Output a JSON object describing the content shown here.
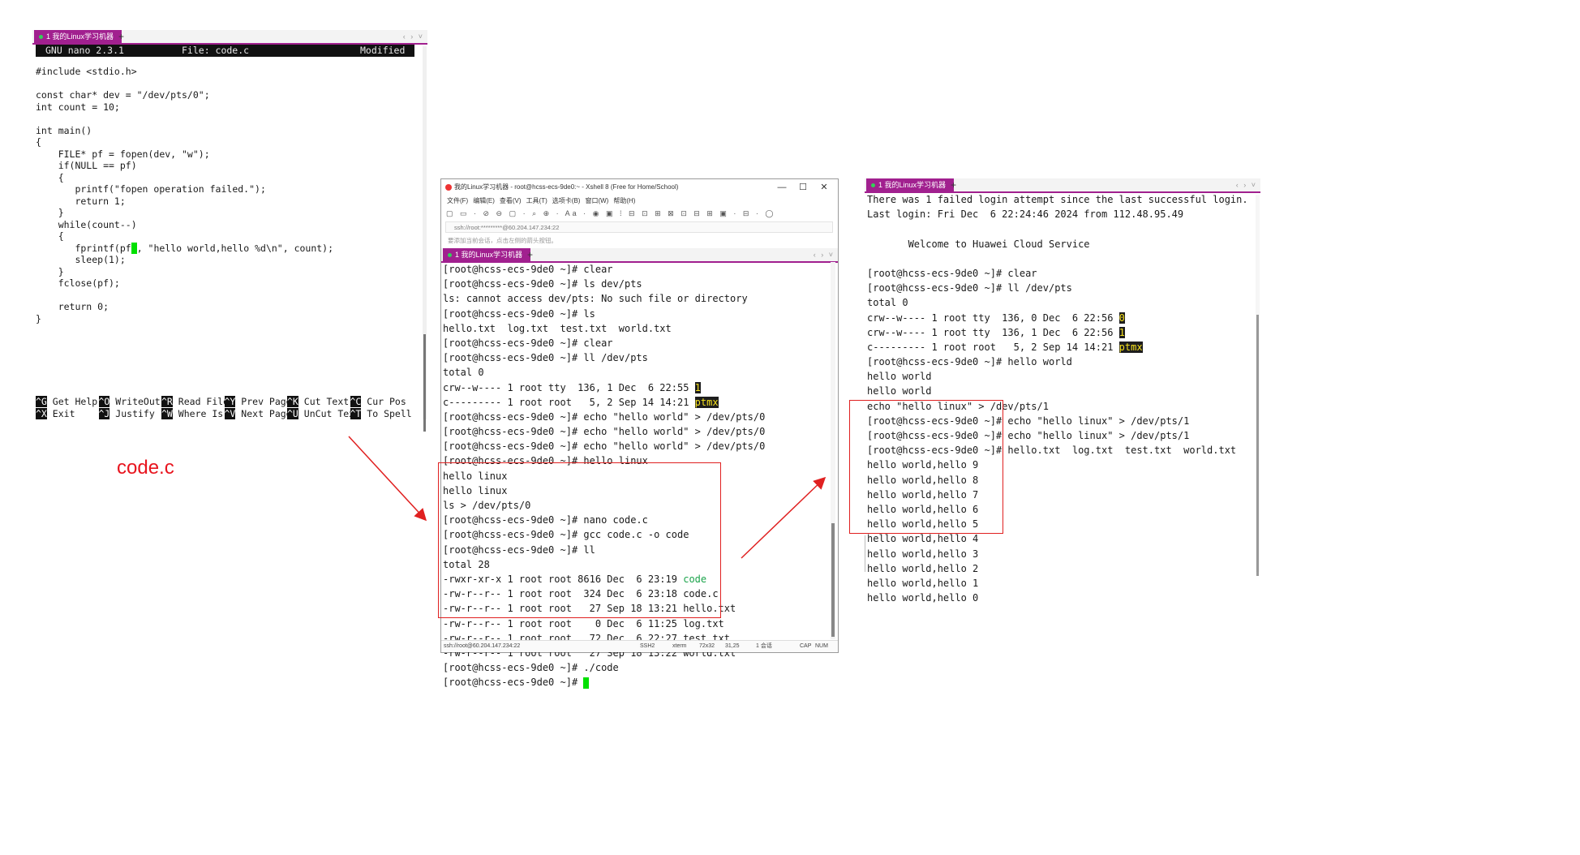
{
  "nano": {
    "tab_label": "1 我的Linux学习机器",
    "tab_plus": "+",
    "tab_nav": "‹ › ˅",
    "header_left": "GNU nano 2.3.1",
    "header_center": "File: code.c",
    "header_right": "Modified",
    "code_lines": [
      "#include <stdio.h>",
      "",
      "const char* dev = \"/dev/pts/0\";",
      "int count = 10;",
      "",
      "int main()",
      "{",
      "    FILE* pf = fopen(dev, \"w\");",
      "    if(NULL == pf)",
      "    {",
      "       printf(\"fopen operation failed.\");",
      "       return 1;",
      "    }",
      "    while(count--)",
      "    {",
      "       fprintf(pf",
      "       sleep(1);",
      "    }",
      "    fclose(pf);",
      "",
      "    return 0;",
      "}"
    ],
    "fprintf_rest": ", \"hello world,hello %d\\n\", count);",
    "shortcuts_row1": [
      {
        "key": "^G",
        "label": "Get Help"
      },
      {
        "key": "^O",
        "label": "WriteOut"
      },
      {
        "key": "^R",
        "label": "Read File"
      },
      {
        "key": "^Y",
        "label": "Prev Page"
      },
      {
        "key": "^K",
        "label": "Cut Text"
      },
      {
        "key": "^C",
        "label": "Cur Pos"
      }
    ],
    "shortcuts_row2": [
      {
        "key": "^X",
        "label": "Exit"
      },
      {
        "key": "^J",
        "label": "Justify"
      },
      {
        "key": "^W",
        "label": "Where Is"
      },
      {
        "key": "^V",
        "label": "Next Page"
      },
      {
        "key": "^U",
        "label": "UnCut Tex"
      },
      {
        "key": "^T",
        "label": "To Spell"
      }
    ]
  },
  "annotation_label": "code.c",
  "xshell": {
    "title": "我的Linux学习机器 - root@hcss-ecs-9de0:~ - Xshell 8 (Free for Home/School)",
    "window_buttons": {
      "minimize": "—",
      "maximize": "☐",
      "close": "✕"
    },
    "menu": [
      "文件(F)",
      "编辑(E)",
      "查看(V)",
      "工具(T)",
      "选项卡(B)",
      "窗口(W)",
      "帮助(H)"
    ],
    "toolbar_glyphs": "▢ ▭ · ⊘ ⊖ ▢ · ⌕ ⊕ · Aa · ◉ ▣ ⁞ ⊟ ⊡ ⊞ ⊠ ⊡ ⊟ ⊞ ▣ · ⊟ · ◯",
    "address": "ssh://root:*********@60.204.147.234:22",
    "tip": "要添加当前会话，点击左侧的箭头按钮。",
    "tab_label": "1 我的Linux学习机器",
    "tab_plus": "+",
    "tab_nav": "‹ › ˅",
    "status": {
      "conn": "ssh://root@60.204.147.234:22",
      "proto": "SSH2",
      "term": "xterm",
      "size": "72x32",
      "pos": "31,25",
      "sessions": "1 会话",
      "caps": "CAP",
      "num": "NUM"
    },
    "lines": [
      "[root@hcss-ecs-9de0 ~]# clear",
      "[root@hcss-ecs-9de0 ~]# ls dev/pts",
      "ls: cannot access dev/pts: No such file or directory",
      "[root@hcss-ecs-9de0 ~]# ls",
      "hello.txt  log.txt  test.txt  world.txt",
      "[root@hcss-ecs-9de0 ~]# clear",
      "[root@hcss-ecs-9de0 ~]# ll /dev/pts",
      "total 0",
      "crw--w---- 1 root tty  136, 1 Dec  6 22:55 ",
      "c--------- 1 root root   5, 2 Sep 14 14:21 ",
      "[root@hcss-ecs-9de0 ~]# echo \"hello world\" > /dev/pts/0",
      "[root@hcss-ecs-9de0 ~]# echo \"hello world\" > /dev/pts/0",
      "[root@hcss-ecs-9de0 ~]# echo \"hello world\" > /dev/pts/0",
      "[root@hcss-ecs-9de0 ~]# hello linux",
      "hello linux",
      "hello linux",
      "ls > /dev/pts/0",
      "[root@hcss-ecs-9de0 ~]# nano code.c",
      "[root@hcss-ecs-9de0 ~]# gcc code.c -o code",
      "[root@hcss-ecs-9de0 ~]# ll",
      "total 28",
      "-rwxr-xr-x 1 root root 8616 Dec  6 23:19 ",
      "-rw-r--r-- 1 root root  324 Dec  6 23:18 code.c",
      "-rw-r--r-- 1 root root   27 Sep 18 13:21 hello.txt",
      "-rw-r--r-- 1 root root    0 Dec  6 11:25 log.txt",
      "-rw-r--r-- 1 root root   72 Dec  6 22:27 test.txt",
      "-rw-r--r-- 1 root root   27 Sep 18 13:22 world.txt",
      "[root@hcss-ecs-9de0 ~]# ./code",
      "[root@hcss-ecs-9de0 ~]# "
    ],
    "hl_pts1": "1",
    "hl_ptmx": "ptmx",
    "exe_name": "code"
  },
  "right": {
    "tab_label": "1 我的Linux学习机器",
    "tab_plus": "+",
    "tab_nav": "‹ › ˅",
    "lines": [
      "There was 1 failed login attempt since the last successful login.",
      "Last login: Fri Dec  6 22:24:46 2024 from 112.48.95.49",
      "",
      "       Welcome to Huawei Cloud Service",
      "",
      "[root@hcss-ecs-9de0 ~]# clear",
      "[root@hcss-ecs-9de0 ~]# ll /dev/pts",
      "total 0",
      "crw--w---- 1 root tty  136, 0 Dec  6 22:56 ",
      "crw--w---- 1 root tty  136, 1 Dec  6 22:56 ",
      "c--------- 1 root root   5, 2 Sep 14 14:21 ",
      "[root@hcss-ecs-9de0 ~]# hello world",
      "hello world",
      "hello world",
      "echo \"hello linux\" > /dev/pts/1",
      "[root@hcss-ecs-9de0 ~]# echo \"hello linux\" > /dev/pts/1",
      "[root@hcss-ecs-9de0 ~]# echo \"hello linux\" > /dev/pts/1",
      "[root@hcss-ecs-9de0 ~]# hello.txt  log.txt  test.txt  world.txt",
      "hello world,hello 9",
      "hello world,hello 8",
      "hello world,hello 7",
      "hello world,hello 6",
      "hello world,hello 5",
      "hello world,hello 4",
      "hello world,hello 3",
      "hello world,hello 2",
      "hello world,hello 1",
      "hello world,hello 0"
    ],
    "hl_pts0": "0",
    "hl_pts1": "1",
    "hl_ptmx": "ptmx"
  },
  "colors": {
    "tab_accent": "#a1208f",
    "annotation_red": "#e02020",
    "cursor_green": "#00e000",
    "highlight_bg": "#1d1d1d",
    "highlight_fg": "#f6e11e"
  }
}
